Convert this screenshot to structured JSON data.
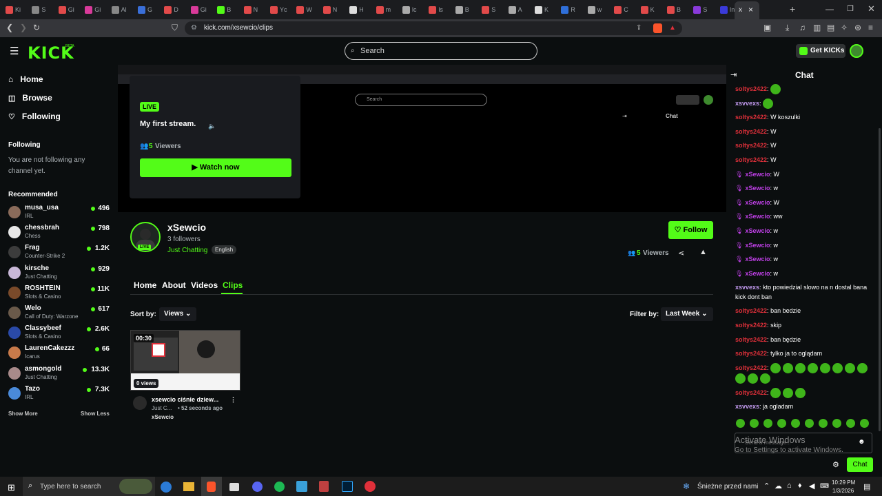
{
  "browser": {
    "tabs": [
      {
        "title": "Ki",
        "color": "#e24a4a"
      },
      {
        "title": "S",
        "color": "#888888"
      },
      {
        "title": "Gi",
        "color": "#e24a4a"
      },
      {
        "title": "Gi",
        "color": "#d93a9a"
      },
      {
        "title": "Al",
        "color": "#888888"
      },
      {
        "title": "G",
        "color": "#3a6fd9"
      },
      {
        "title": "D",
        "color": "#e24a4a"
      },
      {
        "title": "Gi",
        "color": "#d93a9a"
      },
      {
        "title": "B",
        "color": "#53fc18"
      },
      {
        "title": "N",
        "color": "#e24a4a"
      },
      {
        "title": "Yc",
        "color": "#e24a4a"
      },
      {
        "title": "W",
        "color": "#e24a4a"
      },
      {
        "title": "N",
        "color": "#e24a4a"
      },
      {
        "title": "H",
        "color": "#dddddd"
      },
      {
        "title": "m",
        "color": "#e24a4a"
      },
      {
        "title": "lc",
        "color": "#aaaaaa"
      },
      {
        "title": "ls",
        "color": "#e24a4a"
      },
      {
        "title": "B",
        "color": "#aaaaaa"
      },
      {
        "title": "S",
        "color": "#e24a4a"
      },
      {
        "title": "A",
        "color": "#aaaaaa"
      },
      {
        "title": "K",
        "color": "#dddddd"
      },
      {
        "title": "R",
        "color": "#2f6fd9"
      },
      {
        "title": "w",
        "color": "#aaaaaa"
      },
      {
        "title": "C",
        "color": "#e24a4a"
      },
      {
        "title": "K",
        "color": "#e24a4a"
      },
      {
        "title": "B",
        "color": "#e24a4a"
      },
      {
        "title": "S",
        "color": "#8a3adb"
      },
      {
        "title": "In",
        "color": "#3a3ad9"
      }
    ],
    "active_tab": {
      "title": "x",
      "close": "×"
    },
    "new_tab": "+",
    "url": "kick.com/xsewcio/clips"
  },
  "header": {
    "logo": "KICK",
    "logo_badge": "BETA",
    "search_placeholder": "Search",
    "get_kicks_label": "Get KICKs"
  },
  "sidebar": {
    "nav": [
      {
        "label": "Home",
        "icon": "home-icon"
      },
      {
        "label": "Browse",
        "icon": "browse-icon"
      },
      {
        "label": "Following",
        "icon": "heart-icon"
      }
    ],
    "following_title": "Following",
    "following_empty": "You are not following any channel yet.",
    "recommended_title": "Recommended",
    "recommended": [
      {
        "name": "musa_usa",
        "category": "IRL",
        "viewers": "496",
        "color": "#8a6b5a"
      },
      {
        "name": "chessbrah",
        "category": "Chess",
        "viewers": "798",
        "color": "#e8e8e8"
      },
      {
        "name": "Frag",
        "category": "Counter-Strike 2",
        "viewers": "1.2K",
        "color": "#3c3c3c"
      },
      {
        "name": "kirsche",
        "category": "Just Chatting",
        "viewers": "929",
        "color": "#c9b8d8"
      },
      {
        "name": "ROSHTEIN",
        "category": "Slots & Casino",
        "viewers": "11K",
        "color": "#7a4a2a"
      },
      {
        "name": "Welo",
        "category": "Call of Duty: Warzone",
        "viewers": "617",
        "color": "#6a5a4a"
      },
      {
        "name": "Classybeef",
        "category": "Slots & Casino",
        "viewers": "2.6K",
        "color": "#2a4aa8"
      },
      {
        "name": "LaurenCakezzz",
        "category": "Icarus",
        "viewers": "66",
        "color": "#c87a4a"
      },
      {
        "name": "asmongold",
        "category": "Just Chatting",
        "viewers": "13.3K",
        "color": "#a88a8a"
      },
      {
        "name": "Tazo",
        "category": "IRL",
        "viewers": "7.3K",
        "color": "#4a8ad9"
      }
    ],
    "show_more": "Show More",
    "show_less": "Show Less"
  },
  "player_popup": {
    "live_badge": "LIVE",
    "title": "My first stream.",
    "viewers_count": "5",
    "viewers_label": "Viewers",
    "watch_button": "Watch now"
  },
  "embedded_ui": {
    "search": "Search",
    "chat": "Chat"
  },
  "channel": {
    "name": "xSewcio",
    "followers": "3 followers",
    "category": "Just Chatting",
    "language": "English",
    "avatar_live": "LIVE",
    "follow_label": "Follow",
    "viewers_count": "5",
    "viewers_label": "Viewers"
  },
  "tabs": [
    {
      "label": "Home",
      "active": false
    },
    {
      "label": "About",
      "active": false
    },
    {
      "label": "Videos",
      "active": false
    },
    {
      "label": "Clips",
      "active": true
    }
  ],
  "clips": {
    "sort_label": "Sort by:",
    "sort_value": "Views",
    "filter_label": "Filter by:",
    "filter_value": "Last Week",
    "items": [
      {
        "duration": "00:30",
        "views": "0 views",
        "title": "xsewcio ciśnie dziew...",
        "category": "Just C...",
        "age": "• 52 seconds ago",
        "creator": "xSewcio"
      }
    ]
  },
  "chat": {
    "title": "Chat",
    "messages": [
      {
        "user": "soltys2422",
        "user_color": "#e0303a",
        "text": "",
        "emotes": 1,
        "mic": false
      },
      {
        "user": "xsvvexs",
        "user_color": "#c39bf0",
        "text": "",
        "emotes": 1,
        "mic": false
      },
      {
        "user": "soltys2422",
        "user_color": "#e0303a",
        "text": "W koszulki",
        "emotes": 0,
        "mic": false
      },
      {
        "user": "soltys2422",
        "user_color": "#e0303a",
        "text": "W",
        "emotes": 0,
        "mic": false
      },
      {
        "user": "soltys2422",
        "user_color": "#e0303a",
        "text": "W",
        "emotes": 0,
        "mic": false
      },
      {
        "user": "soltys2422",
        "user_color": "#e0303a",
        "text": "W",
        "emotes": 0,
        "mic": false
      },
      {
        "user": "xSewcio",
        "user_color": "#c040e8",
        "text": "W",
        "emotes": 0,
        "mic": true
      },
      {
        "user": "xSewcio",
        "user_color": "#c040e8",
        "text": "w",
        "emotes": 0,
        "mic": true
      },
      {
        "user": "xSewcio",
        "user_color": "#c040e8",
        "text": "W",
        "emotes": 0,
        "mic": true
      },
      {
        "user": "xSewcio",
        "user_color": "#c040e8",
        "text": "ww",
        "emotes": 0,
        "mic": true
      },
      {
        "user": "xSewcio",
        "user_color": "#c040e8",
        "text": "w",
        "emotes": 0,
        "mic": true
      },
      {
        "user": "xSewcio",
        "user_color": "#c040e8",
        "text": "w",
        "emotes": 0,
        "mic": true
      },
      {
        "user": "xSewcio",
        "user_color": "#c040e8",
        "text": "w",
        "emotes": 0,
        "mic": true
      },
      {
        "user": "xSewcio",
        "user_color": "#c040e8",
        "text": "w",
        "emotes": 0,
        "mic": true
      },
      {
        "user": "xsvvexs",
        "user_color": "#c39bf0",
        "text": "kto powiedzial slowo na n dostal bana kick dont ban",
        "emotes": 0,
        "mic": false
      },
      {
        "user": "soltys2422",
        "user_color": "#e0303a",
        "text": "ban bedzie",
        "emotes": 0,
        "mic": false
      },
      {
        "user": "soltys2422",
        "user_color": "#e0303a",
        "text": "skip",
        "emotes": 0,
        "mic": false
      },
      {
        "user": "soltys2422",
        "user_color": "#e0303a",
        "text": "ban będzie",
        "emotes": 0,
        "mic": false
      },
      {
        "user": "soltys2422",
        "user_color": "#e0303a",
        "text": "tylko ja to oglądam",
        "emotes": 0,
        "mic": false
      },
      {
        "user": "soltys2422",
        "user_color": "#e0303a",
        "text": "",
        "emotes": 11,
        "mic": false
      },
      {
        "user": "soltys2422",
        "user_color": "#e0303a",
        "text": "",
        "emotes": 3,
        "mic": false
      },
      {
        "user": "xsvvexs",
        "user_color": "#c39bf0",
        "text": "ja ogladam",
        "emotes": 0,
        "mic": false
      }
    ],
    "emote_bar_count": 10,
    "input_placeholder": "Send a message...",
    "send_label": "Chat",
    "activate_title": "Activate Windows",
    "activate_sub": "Go to Settings to activate Windows."
  },
  "taskbar": {
    "search_placeholder": "Type here to search",
    "weather": "Śnieżne przed nami",
    "time": "10:29 PM",
    "date": "1/3/2026"
  }
}
